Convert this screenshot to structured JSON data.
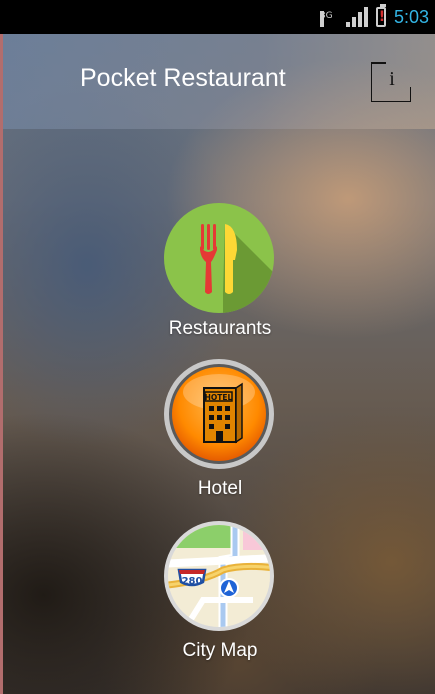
{
  "status_bar": {
    "network_type": "3G",
    "time": "5:03",
    "icons": [
      "signal-icon",
      "battery-alert-icon"
    ]
  },
  "app_bar": {
    "title": "Pocket Restaurant",
    "info_glyph": "i",
    "info_icon": "info-icon"
  },
  "menu": [
    {
      "label": "Restaurants",
      "icon": "fork-knife-icon",
      "color": "#8bc34a"
    },
    {
      "label": "Hotel",
      "icon": "hotel-building-icon",
      "color": "#ff8a00"
    },
    {
      "label": "City Map",
      "icon": "city-map-icon",
      "color": "#f1e8c9"
    }
  ],
  "hotel_sign": "HOTEL",
  "map_shield": "280"
}
